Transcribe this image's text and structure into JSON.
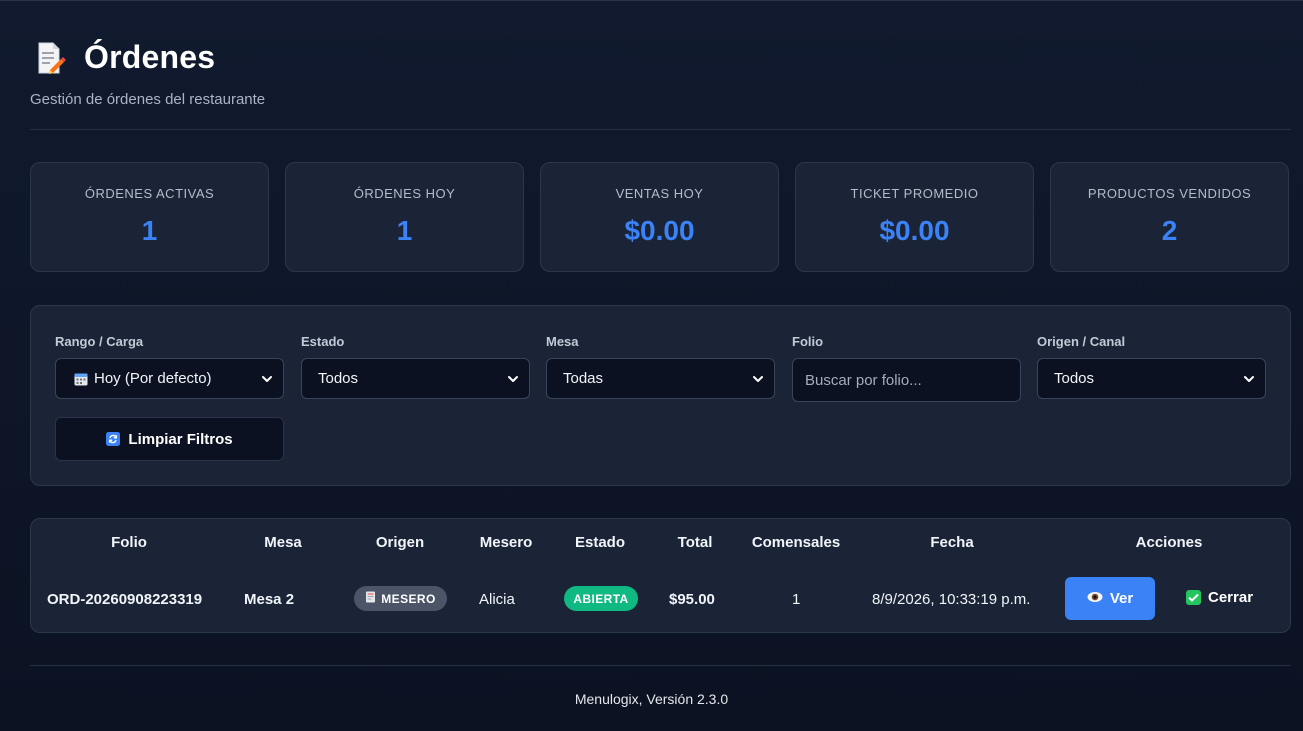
{
  "header": {
    "title": "Órdenes",
    "subtitle": "Gestión de órdenes del restaurante",
    "icon": "memo-icon"
  },
  "stats": [
    {
      "label": "ÓRDENES ACTIVAS",
      "value": "1"
    },
    {
      "label": "ÓRDENES HOY",
      "value": "1"
    },
    {
      "label": "VENTAS HOY",
      "value": "$0.00"
    },
    {
      "label": "TICKET PROMEDIO",
      "value": "$0.00"
    },
    {
      "label": "PRODUCTOS VENDIDOS",
      "value": "2"
    }
  ],
  "filters": {
    "range": {
      "label": "Rango / Carga",
      "value": "Hoy (Por defecto)",
      "icon": "calendar-icon"
    },
    "status": {
      "label": "Estado",
      "value": "Todos"
    },
    "table": {
      "label": "Mesa",
      "value": "Todas"
    },
    "folio": {
      "label": "Folio",
      "placeholder": "Buscar por folio..."
    },
    "origin": {
      "label": "Origen / Canal",
      "value": "Todos"
    },
    "clear_label": "Limpiar Filtros"
  },
  "table": {
    "headers": [
      "Folio",
      "Mesa",
      "Origen",
      "Mesero",
      "Estado",
      "Total",
      "Comensales",
      "Fecha",
      "Acciones"
    ],
    "rows": [
      {
        "folio": "ORD-20260908223319",
        "mesa": "Mesa 2",
        "origen": "MESERO",
        "mesero": "Alicia",
        "estado": "ABIERTA",
        "total": "$95.00",
        "comensales": "1",
        "fecha": "8/9/2026, 10:33:19 p.m.",
        "view_label": "Ver",
        "close_label": "Cerrar"
      }
    ]
  },
  "colors": {
    "accent": "#3b82f6",
    "status_open": "#10b981",
    "background": "#0f172a",
    "card": "#1b2436"
  },
  "footer": {
    "text": "Menulogix, Versión 2.3.0"
  }
}
